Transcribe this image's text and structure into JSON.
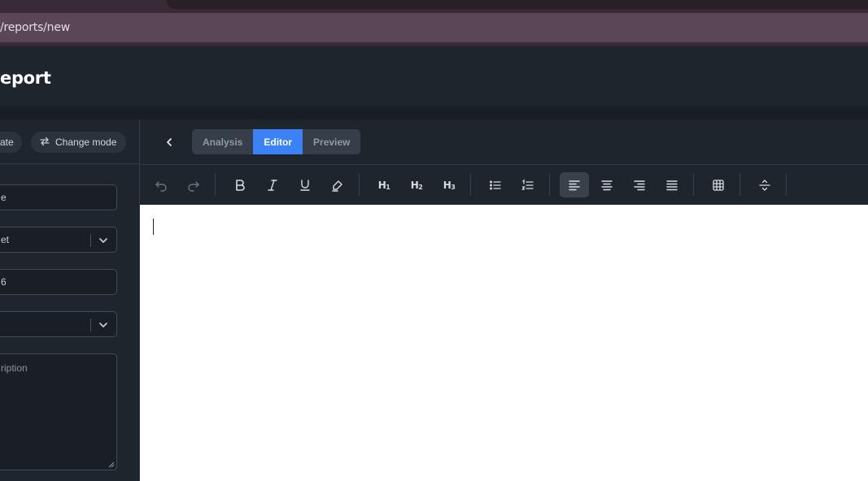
{
  "browser": {
    "url": "/reports/new"
  },
  "header": {
    "title": "eport"
  },
  "left": {
    "template_label": "ate",
    "change_mode_label": "Change mode",
    "fields": {
      "name": "e",
      "set": "et",
      "number": "6",
      "select": "",
      "description_placeholder": "ription"
    }
  },
  "editor": {
    "tabs": [
      "Analysis",
      "Editor",
      "Preview"
    ],
    "active_tab": "Editor",
    "toolbar": {
      "h1": "H1",
      "h2": "H2",
      "h3": "H3"
    }
  },
  "colors": {
    "accent": "#3b82f6",
    "panel": "#1f252d",
    "chrome": "#5a4656"
  }
}
